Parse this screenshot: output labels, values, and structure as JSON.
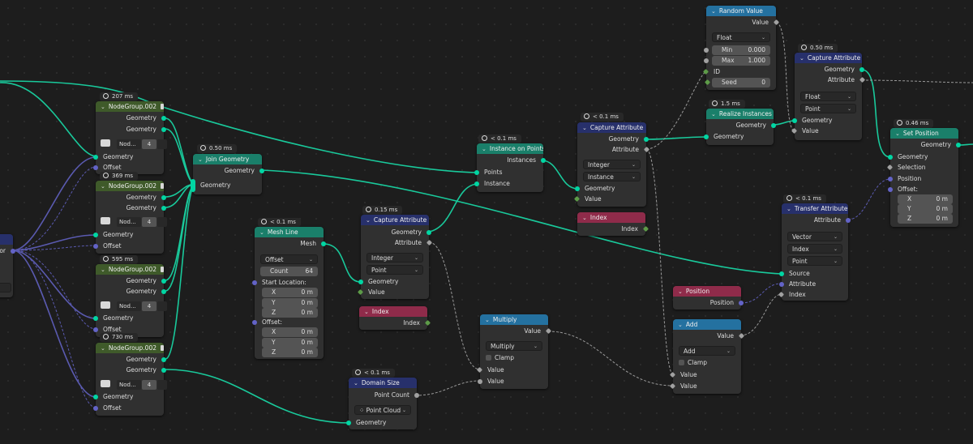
{
  "nodes": {
    "random_value": {
      "title": "Random Value",
      "value": "Value",
      "type": "Float",
      "min_label": "Min",
      "min": "0.000",
      "max_label": "Max",
      "max": "1.000",
      "id": "ID",
      "seed_label": "Seed",
      "seed": "0"
    },
    "capture_attr_top": {
      "timer": "0.50 ms",
      "title": "Capture Attribute",
      "geometry_out": "Geometry",
      "attribute_out": "Attribute",
      "type": "Float",
      "domain": "Point",
      "geometry_in": "Geometry",
      "value_in": "Value"
    },
    "realize": {
      "timer": "1.5 ms",
      "title": "Realize Instances",
      "geometry_out": "Geometry",
      "geometry_in": "Geometry"
    },
    "set_position": {
      "timer": "0.46 ms",
      "title": "Set Position",
      "geometry_out": "Geometry",
      "geometry_in": "Geometry",
      "selection": "Selection",
      "position": "Position",
      "offset": "Offset:",
      "x": "X",
      "xv": "0 m",
      "y": "Y",
      "yv": "0 m",
      "z": "Z",
      "zv": "0 m"
    },
    "capture_attr_mid": {
      "timer": "< 0.1 ms",
      "title": "Capture Attribute",
      "geometry_out": "Geometry",
      "attribute_out": "Attribute",
      "type": "Integer",
      "domain": "Instance",
      "geometry_in": "Geometry",
      "value_in": "Value"
    },
    "index_a": {
      "title": "Index",
      "out": "Index"
    },
    "instance_on_points": {
      "timer": "< 0.1 ms",
      "title": "Instance on Points",
      "instances_out": "Instances",
      "points_in": "Points",
      "instance_in": "Instance"
    },
    "transfer_attr": {
      "timer": "< 0.1 ms",
      "title": "Transfer Attribute",
      "attribute_out": "Attribute",
      "type": "Vector",
      "mode": "Index",
      "domain": "Point",
      "source": "Source",
      "attribute_in": "Attribute",
      "index_in": "Index"
    },
    "position": {
      "title": "Position",
      "out": "Position"
    },
    "add": {
      "title": "Add",
      "value_out": "Value",
      "op": "Add",
      "clamp": "Clamp",
      "v1": "Value",
      "v2": "Value"
    },
    "join": {
      "timer": "0.50 ms",
      "title": "Join Geometry",
      "geometry_out": "Geometry",
      "geometry_in": "Geometry"
    },
    "mesh_line": {
      "timer": "< 0.1 ms",
      "title": "Mesh Line",
      "mesh_out": "Mesh",
      "mode": "Offset",
      "count_label": "Count",
      "count": "64",
      "start": "Start Location:",
      "offset": "Offset:",
      "x": "X",
      "xv": "0 m",
      "y": "Y",
      "yv": "0 m",
      "z": "Z",
      "zv": "0 m",
      "ox": "X",
      "oxv": "0 m",
      "oy": "Y",
      "oyv": "0 m",
      "oz": "Z",
      "ozv": "0 m"
    },
    "capture_attr_low": {
      "timer": "0.15 ms",
      "title": "Capture Attribute",
      "geometry_out": "Geometry",
      "attribute_out": "Attribute",
      "type": "Integer",
      "domain": "Point",
      "geometry_in": "Geometry",
      "value_in": "Value"
    },
    "index_b": {
      "title": "Index",
      "out": "Index"
    },
    "multiply": {
      "title": "Multiply",
      "value_out": "Value",
      "op": "Multiply",
      "clamp": "Clamp",
      "v1": "Value",
      "v2": "Value"
    },
    "domain_size": {
      "timer": "< 0.1 ms",
      "title": "Domain Size",
      "count_out": "Point Count",
      "component": "Point Cloud",
      "geometry_in": "Geometry"
    },
    "group1": {
      "timer": "207 ms",
      "title": "NodeGroup.002",
      "g1": "Geometry",
      "g2": "Geometry",
      "name": "Nod...",
      "count": "4",
      "geometry_in": "Geometry",
      "offset_in": "Offset"
    },
    "group2": {
      "timer": "369 ms",
      "title": "NodeGroup.002",
      "g1": "Geometry",
      "g2": "Geometry",
      "name": "Nod...",
      "count": "4",
      "geometry_in": "Geometry",
      "offset_in": "Offset"
    },
    "group3": {
      "timer": "595 ms",
      "title": "NodeGroup.002",
      "g1": "Geometry",
      "g2": "Geometry",
      "name": "Nod...",
      "count": "4",
      "geometry_in": "Geometry",
      "offset_in": "Offset"
    },
    "group4": {
      "timer": "730 ms",
      "title": "NodeGroup.002",
      "g1": "Geometry",
      "g2": "Geometry",
      "name": "Nod...",
      "count": "4",
      "geometry_in": "Geometry",
      "offset_in": "Offset"
    },
    "edge_vector": {
      "label": "ctor"
    }
  },
  "colors": {
    "geometry_socket": "#00d6a3",
    "float_socket": "#a1a1a1",
    "vector_socket": "#6363c7",
    "int_socket": "#5d9b48",
    "geometry_header": "#1a7f6a",
    "attribute_header": "#27306b",
    "utility_header": "#2471a0",
    "input_header": "#8f2b4a",
    "group_header": "#3f5a2a"
  }
}
